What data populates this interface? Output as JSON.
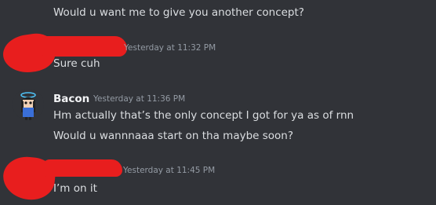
{
  "messages": [
    {
      "text": "Would u want me to give you another concept?"
    },
    {
      "timestamp": "Yesterday at 11:32 PM",
      "text": "Sure cuh"
    },
    {
      "author": "Bacon",
      "timestamp": "Yesterday at 11:36 PM",
      "lines": [
        "Hm actually that’s the only concept I got for ya as of rnn",
        "Would u wannnaaa start on tha maybe soon?"
      ]
    },
    {
      "timestamp": "Yesterday at 11:45 PM",
      "text": "I’m on it"
    }
  ],
  "colors": {
    "background": "#313338",
    "text": "#dbdee1",
    "timestamp": "#949ba4",
    "redaction": "#e81e1e"
  }
}
